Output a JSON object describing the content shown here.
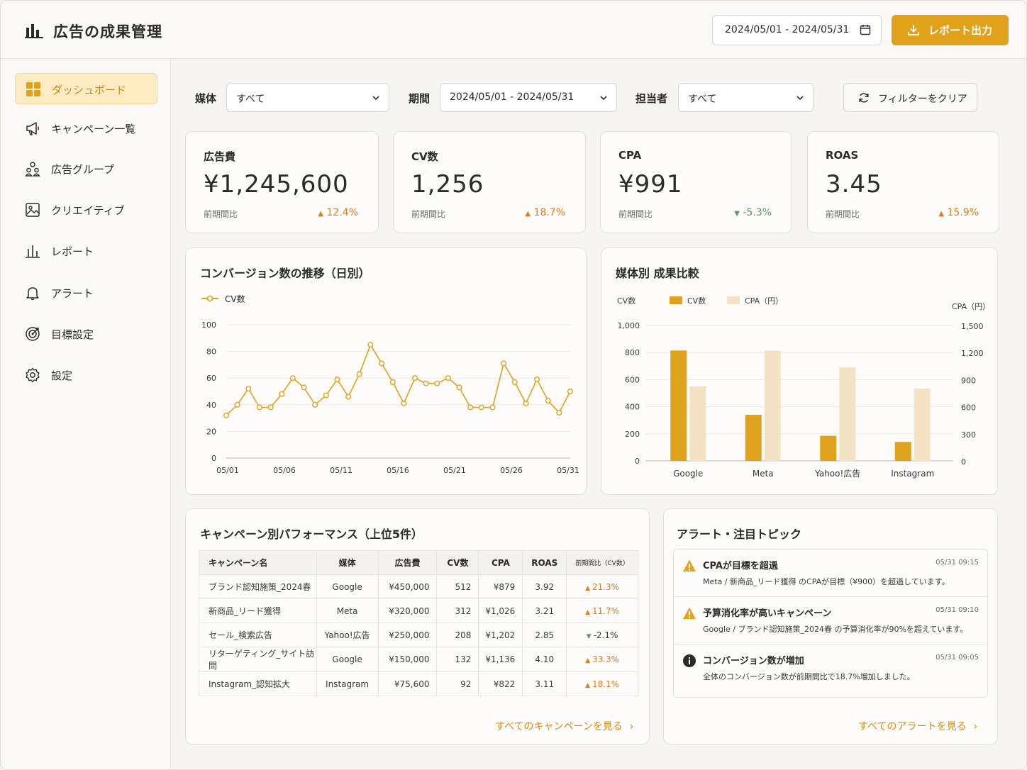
{
  "header": {
    "title": "広告の成果管理",
    "date_range": "2024/05/01 - 2024/05/31",
    "export_label": "レポート出力"
  },
  "sidebar": {
    "items": [
      {
        "label": "ダッシュボード",
        "icon": "grid-icon",
        "active": true
      },
      {
        "label": "キャンペーン一覧",
        "icon": "megaphone-icon"
      },
      {
        "label": "広告グループ",
        "icon": "group-icon"
      },
      {
        "label": "クリエイティブ",
        "icon": "image-icon"
      },
      {
        "label": "レポート",
        "icon": "bar-chart-icon"
      },
      {
        "label": "アラート",
        "icon": "bell-icon"
      },
      {
        "label": "目標設定",
        "icon": "target-icon"
      },
      {
        "label": "設定",
        "icon": "gear-icon"
      }
    ]
  },
  "filters": {
    "media_label": "媒体",
    "media_value": "すべて",
    "period_label": "期間",
    "period_value": "2024/05/01 - 2024/05/31",
    "owner_label": "担当者",
    "owner_value": "すべて",
    "clear_label": "フィルターをクリア"
  },
  "kpis": [
    {
      "label": "広告費",
      "value": "¥1,245,600",
      "sub": "前期間比",
      "delta": "12.4%",
      "dir": "up"
    },
    {
      "label": "CV数",
      "value": "1,256",
      "sub": "前期間比",
      "delta": "18.7%",
      "dir": "up"
    },
    {
      "label": "CPA",
      "value": "¥991",
      "sub": "前期間比",
      "delta": "-5.3%",
      "dir": "down"
    },
    {
      "label": "ROAS",
      "value": "3.45",
      "sub": "前期間比",
      "delta": "15.9%",
      "dir": "up"
    }
  ],
  "colors": {
    "accent": "#e1a11a",
    "bar_cv": "#dfa21c",
    "bar_cpa": "#f3e3c4",
    "up": "#e07b1a",
    "down": "#5a9a5c"
  },
  "line_chart": {
    "title": "コンバージョン数の推移（日別）"
  },
  "bar_chart": {
    "title": "媒体別 成果比較"
  },
  "chart_data": [
    {
      "type": "line",
      "title": "コンバージョン数の推移（日別）",
      "series": [
        {
          "name": "CV数",
          "values": [
            32,
            40,
            52,
            38,
            38,
            48,
            60,
            53,
            40,
            47,
            59,
            46,
            63,
            85,
            71,
            57,
            41,
            60,
            56,
            56,
            60,
            53,
            38,
            38,
            38,
            71,
            57,
            41,
            59,
            43,
            34,
            50
          ]
        }
      ],
      "x": [
        1,
        2,
        3,
        4,
        5,
        6,
        7,
        8,
        9,
        10,
        11,
        12,
        13,
        14,
        15,
        16,
        17,
        18,
        19,
        20,
        21,
        22,
        23,
        24,
        25,
        26,
        27,
        28,
        29,
        30,
        31
      ],
      "x_tick_labels": [
        "05/01",
        "05/06",
        "05/11",
        "05/16",
        "05/21",
        "05/26",
        "05/31"
      ],
      "y_tick_labels": [
        "0",
        "20",
        "40",
        "60",
        "80",
        "100"
      ],
      "ylim": [
        0,
        100
      ],
      "grid": true,
      "legend": "top-left"
    },
    {
      "type": "bar",
      "title": "媒体別 成果比較",
      "categories": [
        "Google",
        "Meta",
        "Yahoo!広告",
        "Instagram"
      ],
      "series": [
        {
          "name": "CV数",
          "values": [
            815,
            340,
            185,
            140
          ],
          "axis": "left"
        },
        {
          "name": "CPA（円）",
          "values": [
            825,
            1220,
            1035,
            800
          ],
          "axis": "right"
        }
      ],
      "ylabel": "CV数",
      "y2label": "CPA（円）",
      "ylim": [
        0,
        1000
      ],
      "y2lim": [
        0,
        1500
      ],
      "y_tick_labels": [
        "0",
        "200",
        "400",
        "600",
        "800",
        "1,000"
      ],
      "y2_tick_labels": [
        "0",
        "300",
        "600",
        "900",
        "1,200",
        "1,500"
      ],
      "legend": "top-left"
    }
  ],
  "campaign_table": {
    "title": "キャンペーン別パフォーマンス（上位5件）",
    "headers": [
      "キャンペーン名",
      "媒体",
      "広告費",
      "CV数",
      "CPA",
      "ROAS",
      "前期間比（CV数）"
    ],
    "rows": [
      {
        "name": "ブランド認知施策_2024春",
        "media": "Google",
        "spend": "¥450,000",
        "cv": "512",
        "cpa": "¥879",
        "roas": "3.92",
        "delta": "21.3%",
        "dir": "up"
      },
      {
        "name": "新商品_リード獲得",
        "media": "Meta",
        "spend": "¥320,000",
        "cv": "312",
        "cpa": "¥1,026",
        "roas": "3.21",
        "delta": "11.7%",
        "dir": "up"
      },
      {
        "name": "セール_検索広告",
        "media": "Yahoo!広告",
        "spend": "¥250,000",
        "cv": "208",
        "cpa": "¥1,202",
        "roas": "2.85",
        "delta": "-2.1%",
        "dir": "down"
      },
      {
        "name": "リターゲティング_サイト訪問",
        "media": "Google",
        "spend": "¥150,000",
        "cv": "132",
        "cpa": "¥1,136",
        "roas": "4.10",
        "delta": "33.3%",
        "dir": "up"
      },
      {
        "name": "Instagram_認知拡大",
        "media": "Instagram",
        "spend": "¥75,600",
        "cv": "92",
        "cpa": "¥822",
        "roas": "3.11",
        "delta": "18.1%",
        "dir": "up"
      }
    ],
    "view_all": "すべてのキャンペーンを見る"
  },
  "alerts": {
    "title": "アラート・注目トピック",
    "items": [
      {
        "icon": "warning-icon",
        "title": "CPAが目標を超過",
        "time": "05/31 09:15",
        "desc": "Meta / 新商品_リード獲得 のCPAが目標（¥900）を超過しています。"
      },
      {
        "icon": "warning-icon",
        "title": "予算消化率が高いキャンペーン",
        "time": "05/31 09:10",
        "desc": "Google / ブランド認知施策_2024春 の予算消化率が90%を超えています。"
      },
      {
        "icon": "info-icon",
        "title": "コンバージョン数が増加",
        "time": "05/31 09:05",
        "desc": "全体のコンバージョン数が前期間比で18.7%増加しました。"
      }
    ],
    "view_all": "すべてのアラートを見る"
  }
}
